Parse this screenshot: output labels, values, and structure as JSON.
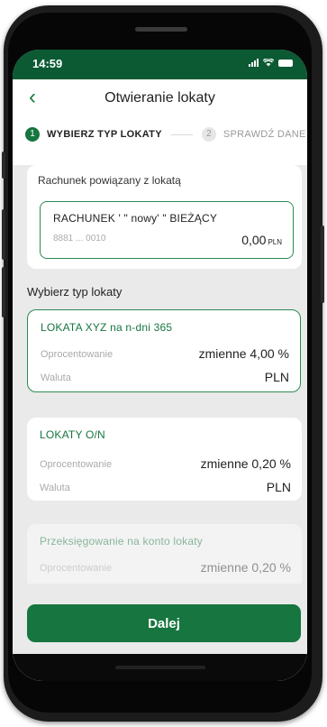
{
  "status_bar": {
    "time": "14:59"
  },
  "header": {
    "title": "Otwieranie lokaty",
    "back_icon": "‹"
  },
  "steps": [
    {
      "number": "1",
      "label": "WYBIERZ TYP LOKATY"
    },
    {
      "number": "2",
      "label": "SPRAWDŹ DANE L"
    }
  ],
  "account_section": {
    "label": "Rachunek powiązany z lokatą",
    "account_name": "RACHUNEK ' \" nowy' \" BIEŻĄCY",
    "account_number": "8881 ... 0010",
    "balance": "0,00",
    "currency": "PLN"
  },
  "deposits_title": "Wybierz typ lokaty",
  "deposits": [
    {
      "name": "LOKATA XYZ na n-dni 365",
      "rate_label": "Oprocentowanie",
      "rate": "zmienne 4,00 %",
      "currency_label": "Waluta",
      "currency": "PLN"
    },
    {
      "name": "LOKATY O/N",
      "rate_label": "Oprocentowanie",
      "rate": "zmienne 0,20 %",
      "currency_label": "Waluta",
      "currency": "PLN"
    },
    {
      "name": "Przeksięgowanie na konto lokaty",
      "rate_label": "Oprocentowanie",
      "rate": "zmienne 0,20 %"
    }
  ],
  "next_button": "Dalej",
  "colors": {
    "accent": "#17753f",
    "status_bar": "#0b5a34",
    "background": "#e9eae9"
  }
}
